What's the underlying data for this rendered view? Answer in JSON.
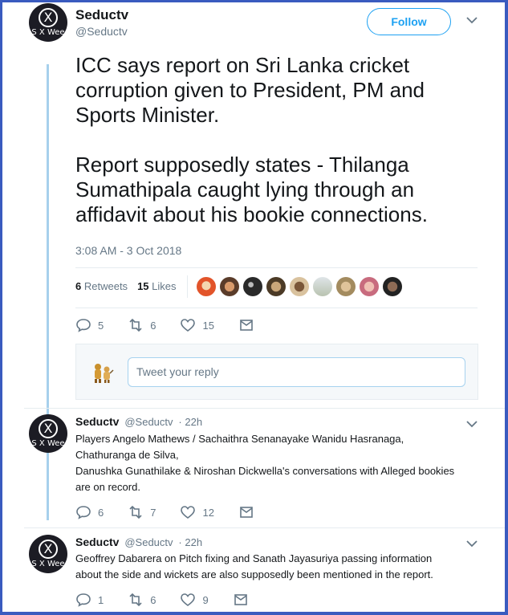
{
  "author": {
    "name": "Seductv",
    "handle": "@Seductv",
    "avatar_caption": "S X Wee"
  },
  "follow_label": "Follow",
  "tweet": {
    "paragraph1": "ICC says report on Sri Lanka cricket corruption given to President, PM and Sports Minister.",
    "paragraph2": "Report supposedly states - Thilanga Sumathipala caught lying through an affidavit about his bookie connections.",
    "timestamp": "3:08 AM - 3 Oct 2018",
    "retweets_count": "6",
    "retweets_label": "Retweets",
    "likes_count": "15",
    "likes_label": "Likes",
    "actions": {
      "replies": "5",
      "retweets": "6",
      "likes": "15"
    }
  },
  "reply_box": {
    "placeholder": "Tweet your reply"
  },
  "replies": [
    {
      "name": "Seductv",
      "handle": "@Seductv",
      "time": "· 22h",
      "lines": [
        "Players Angelo Mathews / Sachaithra Senanayake  Wanidu Hasranaga,",
        "Chathuranga de Silva,",
        "Danushka Gunathilake & Niroshan Dickwella's conversations with Alleged bookies",
        "are on record."
      ],
      "actions": {
        "replies": "6",
        "retweets": "7",
        "likes": "12"
      }
    },
    {
      "name": "Seductv",
      "handle": "@Seductv",
      "time": "· 22h",
      "lines": [
        "Geoffrey Dabarera on Pitch fixing and Sanath Jayasuriya passing information",
        "about the side and wickets are also supposedly been mentioned in the report."
      ],
      "actions": {
        "replies": "1",
        "retweets": "6",
        "likes": "9"
      }
    }
  ],
  "colors": {
    "accent": "#1da1f2",
    "muted": "#657786",
    "thread_line": "#a7d0ec",
    "frame": "#3a5bbf"
  },
  "icons": [
    "chevron-down-icon",
    "reply-icon",
    "retweet-icon",
    "heart-icon",
    "mail-icon"
  ]
}
